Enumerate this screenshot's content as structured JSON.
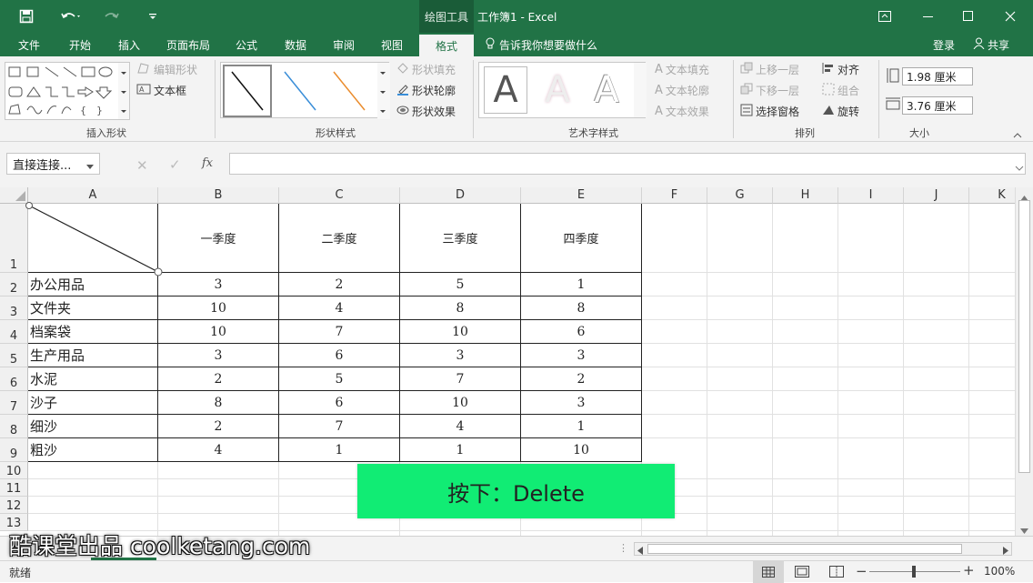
{
  "titlebar": {
    "context_tool": "绘图工具",
    "title": "工作簿1 - Excel",
    "icons": [
      "save-icon",
      "undo-icon",
      "redo-icon",
      "customize-qat-icon",
      "ribbon-display-icon",
      "minimize-icon",
      "maximize-icon",
      "close-icon"
    ]
  },
  "tabs": [
    {
      "label": "文件"
    },
    {
      "label": "开始"
    },
    {
      "label": "插入"
    },
    {
      "label": "页面布局"
    },
    {
      "label": "公式"
    },
    {
      "label": "数据"
    },
    {
      "label": "审阅"
    },
    {
      "label": "视图"
    },
    {
      "label": "格式"
    }
  ],
  "tellme": "告诉我你想要做什么",
  "login": "登录",
  "share": "共享",
  "ribbon": {
    "insert_shapes": {
      "edit_shape": "编辑形状",
      "text_box": "文本框",
      "label": "插入形状"
    },
    "shape_styles": {
      "fill": "形状填充",
      "outline": "形状轮廓",
      "effects": "形状效果",
      "label": "形状样式"
    },
    "wordart": {
      "text_fill": "文本填充",
      "text_outline": "文本轮廓",
      "text_effects": "文本效果",
      "label": "艺术字样式",
      "sample": "A"
    },
    "arrange": {
      "bring_forward": "上移一层",
      "send_backward": "下移一层",
      "selection_pane": "选择窗格",
      "align": "对齐",
      "group": "组合",
      "rotate": "旋转",
      "label": "排列"
    },
    "size": {
      "height": "1.98 厘米",
      "width": "3.76 厘米",
      "label": "大小"
    }
  },
  "formula_bar": {
    "name_box": "直接连接...",
    "fx": "fx",
    "value": ""
  },
  "columns": [
    "A",
    "B",
    "C",
    "D",
    "E",
    "F",
    "G",
    "H",
    "I",
    "J",
    "K"
  ],
  "rows": [
    "1",
    "2",
    "3",
    "4",
    "5",
    "6",
    "7",
    "8",
    "9",
    "10",
    "11",
    "12",
    "13"
  ],
  "table": {
    "headers": [
      "一季度",
      "二季度",
      "三季度",
      "四季度"
    ],
    "rows": [
      {
        "name": "办公用品",
        "values": [
          "3",
          "2",
          "5",
          "1"
        ]
      },
      {
        "name": "文件夹",
        "values": [
          "10",
          "4",
          "8",
          "8"
        ]
      },
      {
        "name": "档案袋",
        "values": [
          "10",
          "7",
          "10",
          "6"
        ]
      },
      {
        "name": "生产用品",
        "values": [
          "3",
          "6",
          "3",
          "3"
        ]
      },
      {
        "name": "水泥",
        "values": [
          "2",
          "5",
          "7",
          "2"
        ]
      },
      {
        "name": "沙子",
        "values": [
          "8",
          "6",
          "10",
          "3"
        ]
      },
      {
        "name": "细沙",
        "values": [
          "2",
          "7",
          "4",
          "1"
        ]
      },
      {
        "name": "粗沙",
        "values": [
          "4",
          "1",
          "1",
          "10"
        ]
      }
    ]
  },
  "banner": "按下：Delete",
  "watermark": "酷课堂出品 coolketang.com",
  "status": {
    "ready": "就绪",
    "zoom": "100%"
  }
}
